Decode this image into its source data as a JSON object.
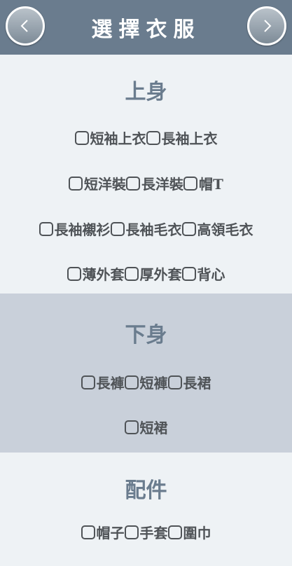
{
  "header": {
    "title": "選擇衣服",
    "back_icon": "chevron-left-icon",
    "next_icon": "chevron-right-icon"
  },
  "sections": {
    "tops": {
      "title": "上身",
      "rows": [
        [
          "短袖上衣",
          "長袖上衣"
        ],
        [
          "短洋裝",
          "長洋裝",
          "帽T"
        ],
        [
          "長袖襯衫",
          "長袖毛衣",
          "高領毛衣"
        ],
        [
          "薄外套",
          "厚外套",
          "背心"
        ]
      ]
    },
    "bottoms": {
      "title": "下身",
      "rows": [
        [
          "長褲",
          "短褲",
          "長裙"
        ],
        [
          "短裙"
        ]
      ]
    },
    "accessories": {
      "title": "配件",
      "rows": [
        [
          "帽子",
          "手套",
          "圍巾"
        ]
      ]
    }
  },
  "colors": {
    "header_bg": "#6a7c8e",
    "section_light": "#eef2f5",
    "section_dark": "#c9d0da",
    "title_text": "#6a7c8e",
    "option_text": "#4f5357"
  }
}
